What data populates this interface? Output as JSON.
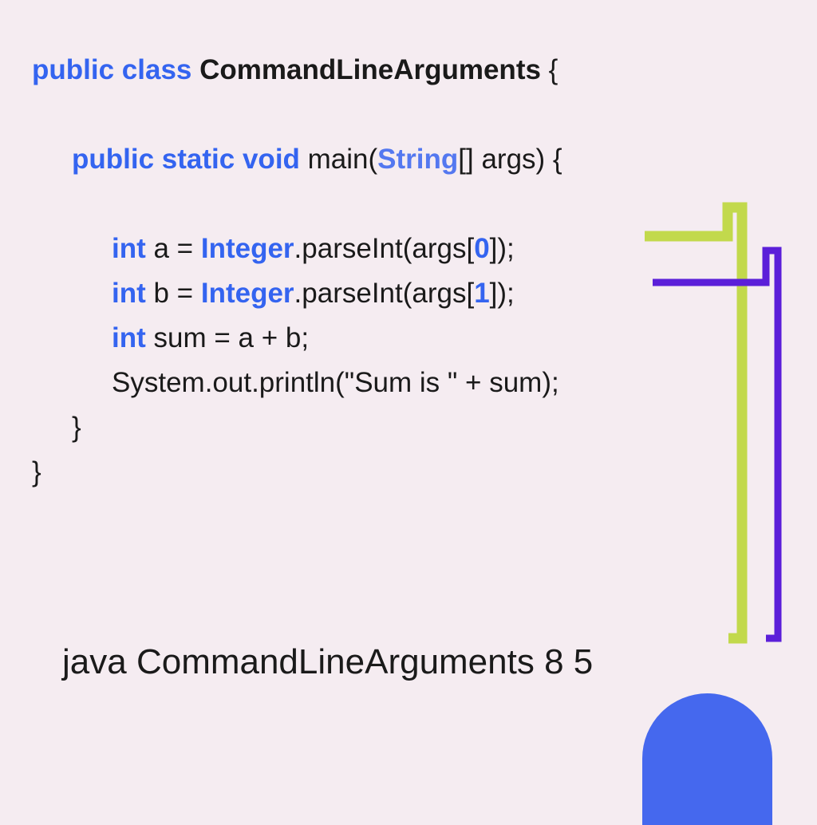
{
  "code": {
    "line1": {
      "public": "public",
      "class": "class",
      "className": "CommandLineArguments",
      "brace": " {"
    },
    "line2": {
      "public": "public",
      "static": "static",
      "void": "void",
      "main": " main(",
      "string": "String",
      "args": "[] args) {"
    },
    "line3": {
      "int": "int",
      "var": " a = ",
      "integer": "Integer",
      "parse": ".parseInt(args[",
      "num": "0",
      "close": "]);"
    },
    "line4": {
      "int": "int",
      "var": " b = ",
      "integer": "Integer",
      "parse": ".parseInt(args[",
      "num": "1",
      "close": "]);"
    },
    "line5": {
      "int": "int",
      "rest": " sum = a + b;"
    },
    "line6": {
      "text": "System.out.println(\"Sum is \" + sum);"
    },
    "line7": {
      "brace": "}"
    },
    "line8": {
      "brace": "}"
    }
  },
  "command": {
    "text": "java CommandLineArguments 8 5"
  }
}
